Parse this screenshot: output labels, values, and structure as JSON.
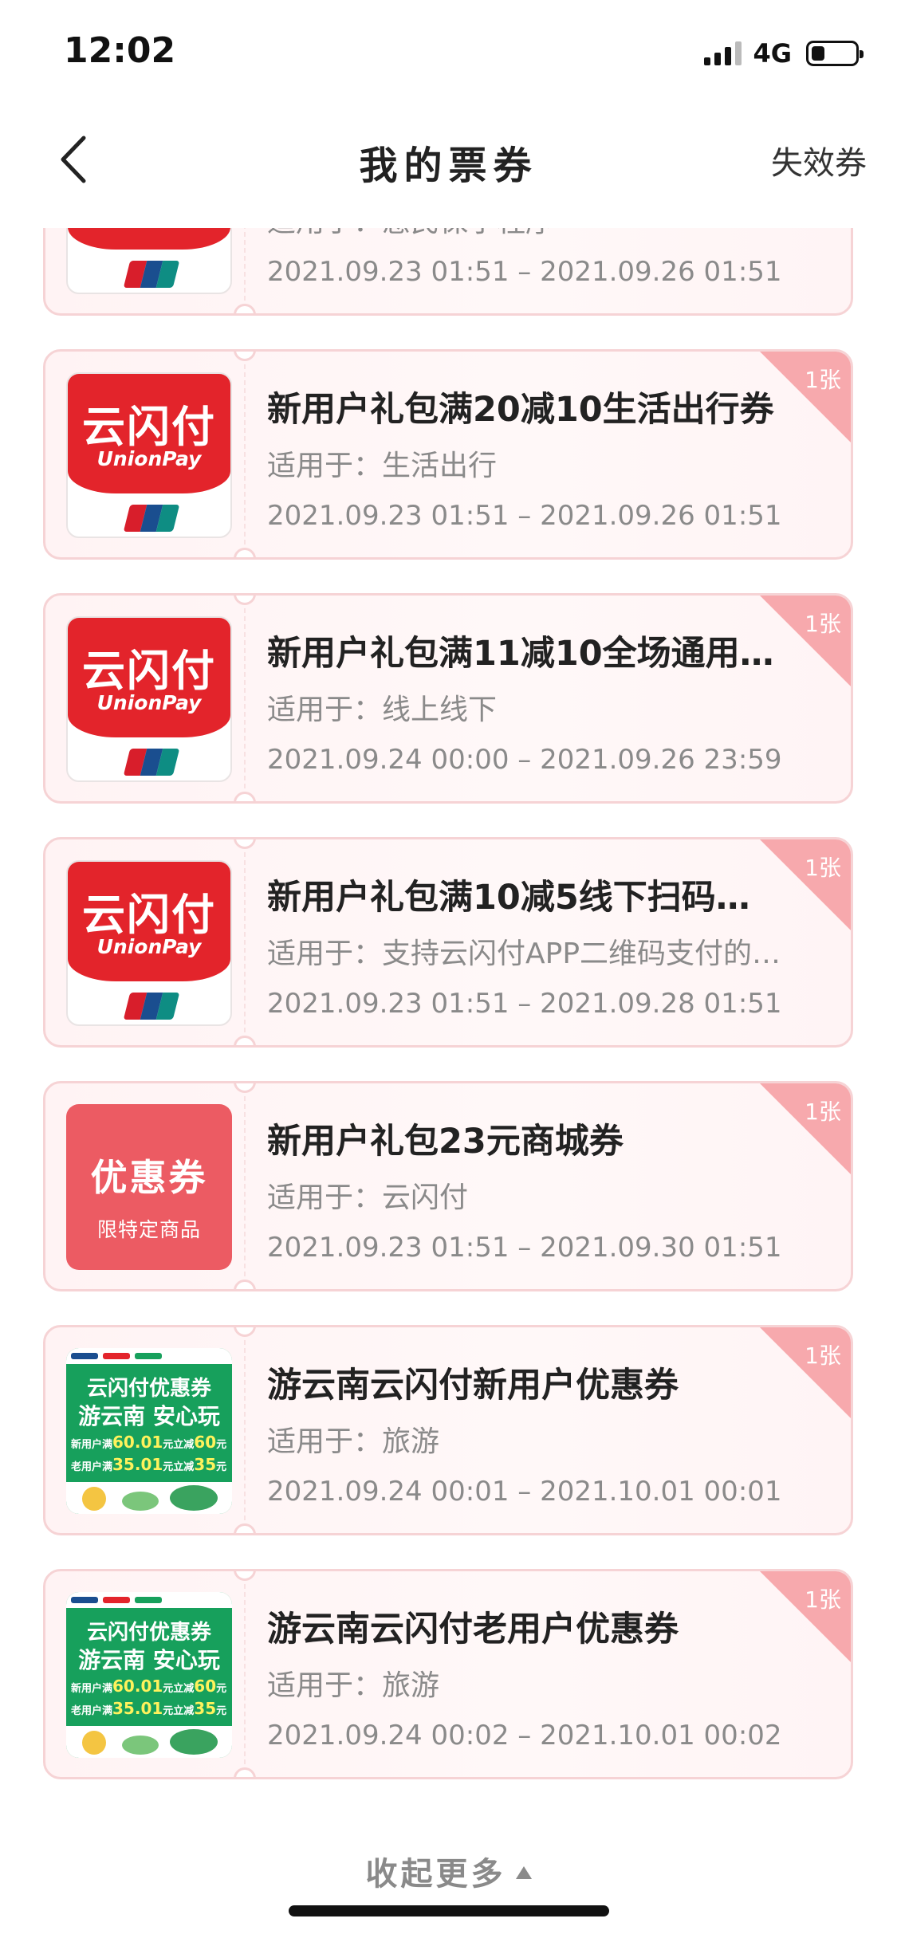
{
  "status_bar": {
    "time": "12:02",
    "network": "4G",
    "battery_level": 0.3
  },
  "nav": {
    "title": "我的票券",
    "right_label": "失效券"
  },
  "coupons": [
    {
      "thumb": "unionpay",
      "title": "",
      "scope": "适用于：惠民保小程序",
      "date": "2021.09.23 01:51 – 2021.09.26 01:51",
      "badge": ""
    },
    {
      "thumb": "unionpay",
      "title": "新用户礼包满20减10生活出行券",
      "scope": "适用于：生活出行",
      "date": "2021.09.23 01:51 – 2021.09.26 01:51",
      "badge": "1张"
    },
    {
      "thumb": "unionpay",
      "title": "新用户礼包满11减10全场通用…",
      "scope": "适用于：线上线下",
      "date": "2021.09.24 00:00 – 2021.09.26 23:59",
      "badge": "1张"
    },
    {
      "thumb": "unionpay",
      "title": "新用户礼包满10减5线下扫码…",
      "scope": "适用于：支持云闪付APP二维码支付的…",
      "date": "2021.09.23 01:51 – 2021.09.28 01:51",
      "badge": "1张"
    },
    {
      "thumb": "coupon",
      "title": "新用户礼包23元商城券",
      "scope": "适用于：云闪付",
      "date": "2021.09.23 01:51 – 2021.09.30 01:51",
      "badge": "1张"
    },
    {
      "thumb": "yunnan",
      "title": "游云南云闪付新用户优惠券",
      "scope": "适用于：旅游",
      "date": "2021.09.24 00:01 – 2021.10.01 00:01",
      "badge": "1张"
    },
    {
      "thumb": "yunnan",
      "title": "游云南云闪付老用户优惠券",
      "scope": "适用于：旅游",
      "date": "2021.09.24 00:02 – 2021.10.01 00:02",
      "badge": "1张"
    }
  ],
  "thumbs": {
    "unionpay": {
      "cn": "云闪付",
      "en": "UnionPay"
    },
    "coupon": {
      "title": "优惠券",
      "sub": "限特定商品"
    },
    "yunnan": {
      "line1": "云闪付优惠券",
      "line2": "游云南 安心玩",
      "new_prefix": "新用户满",
      "new_amount": "60.01",
      "new_mid": "元立减",
      "new_off": "60",
      "new_unit": "元",
      "old_prefix": "老用户满",
      "old_amount": "35.01",
      "old_mid": "元立减",
      "old_off": "35",
      "old_unit": "元"
    }
  },
  "footer": {
    "collapse_label": "收起更多"
  },
  "colors": {
    "accent_red": "#e3242b",
    "badge_pink": "#f7a9ad",
    "card_border": "#f6d3d5",
    "coupon_pink": "#ec5b63",
    "yunnan_green": "#17a05c"
  }
}
